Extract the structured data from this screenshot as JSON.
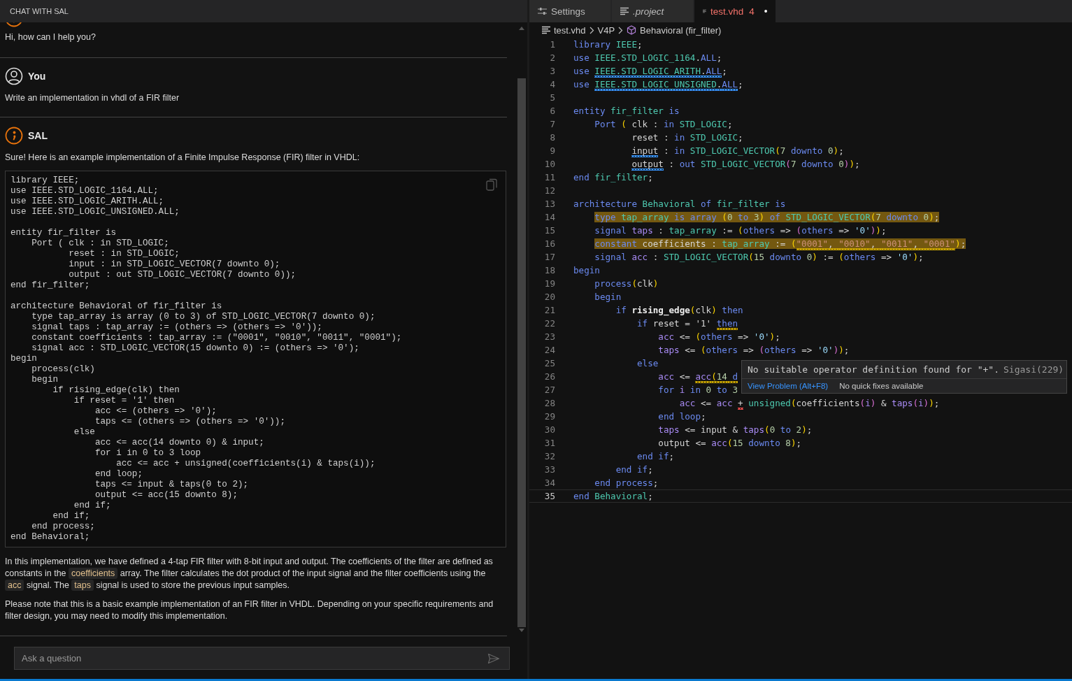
{
  "chat": {
    "title": "CHAT WITH SAL",
    "messages": [
      {
        "kind": "assistant",
        "clipped": true,
        "blocks": [
          {
            "kind": "text",
            "text": "Hi, how can I help you?"
          }
        ]
      },
      {
        "kind": "user",
        "clipped": false,
        "author": "You",
        "blocks": [
          {
            "kind": "text",
            "text": "Write an implementation in vhdl of a FIR filter"
          }
        ]
      },
      {
        "kind": "assistant",
        "clipped": false,
        "author": "SAL",
        "blocks": [
          {
            "kind": "text",
            "text": "Sure! Here is an example implementation of a Finite Impulse Response (FIR) filter in VHDL:"
          },
          {
            "kind": "code",
            "code": "library IEEE;\nuse IEEE.STD_LOGIC_1164.ALL;\nuse IEEE.STD_LOGIC_ARITH.ALL;\nuse IEEE.STD_LOGIC_UNSIGNED.ALL;\n\nentity fir_filter is\n    Port ( clk : in STD_LOGIC;\n           reset : in STD_LOGIC;\n           input : in STD_LOGIC_VECTOR(7 downto 0);\n           output : out STD_LOGIC_VECTOR(7 downto 0));\nend fir_filter;\n\narchitecture Behavioral of fir_filter is\n    type tap_array is array (0 to 3) of STD_LOGIC_VECTOR(7 downto 0);\n    signal taps : tap_array := (others => (others => '0'));\n    constant coefficients : tap_array := (\"0001\", \"0010\", \"0011\", \"0001\");\n    signal acc : STD_LOGIC_VECTOR(15 downto 0) := (others => '0');\nbegin\n    process(clk)\n    begin\n        if rising_edge(clk) then\n            if reset = '1' then\n                acc <= (others => '0');\n                taps <= (others => (others => '0'));\n            else\n                acc <= acc(14 downto 0) & input;\n                for i in 0 to 3 loop\n                    acc <= acc + unsigned(coefficients(i) & taps(i));\n                end loop;\n                taps <= input & taps(0 to 2);\n                output <= acc(15 downto 8);\n            end if;\n        end if;\n    end process;\nend Behavioral;"
          },
          {
            "kind": "rich",
            "parts": [
              {
                "text": "In this implementation, we have defined a 4-tap FIR filter with 8-bit input and output. The coefficients of the filter are defined as constants in the "
              },
              {
                "text": "coefficients",
                "code": true
              },
              {
                "text": " array. The filter calculates the dot product of the input signal and the filter coefficients using the "
              },
              {
                "text": "acc",
                "code": true
              },
              {
                "text": " signal. The "
              },
              {
                "text": "taps",
                "code": true
              },
              {
                "text": " signal is used to store the previous input samples."
              }
            ]
          },
          {
            "kind": "text",
            "text": "Please note that this is a basic example implementation of an FIR filter in VHDL. Depending on your specific requirements and filter design, you may need to modify this implementation."
          }
        ]
      }
    ],
    "input": {
      "placeholder": "Ask a question"
    }
  },
  "editor": {
    "tabs": [
      {
        "label": "Settings",
        "kind": "settings",
        "selected": false,
        "preview": false,
        "modified": false
      },
      {
        "label": ".project",
        "kind": "file",
        "selected": false,
        "preview": true,
        "modified": false
      },
      {
        "label": "test.vhd",
        "kind": "file",
        "selected": true,
        "preview": false,
        "modified": true,
        "problems": "4"
      }
    ],
    "breadcrumb": [
      {
        "label": "test.vhd",
        "kind": "file"
      },
      {
        "label": "V4P",
        "kind": "plain"
      },
      {
        "label": "Behavioral (fir_filter)",
        "kind": "symbol"
      }
    ],
    "lines": [
      {
        "n": "1",
        "seg": [
          {
            "text": "library",
            "kind": "keyword"
          },
          {
            "text": " IEEE",
            "kind": "type"
          },
          {
            "text": ";",
            "kind": "plain"
          }
        ]
      },
      {
        "n": "2",
        "seg": [
          {
            "text": "use ",
            "kind": "keyword"
          },
          {
            "text": "IEEE.STD_LOGIC_1164",
            "kind": "type"
          },
          {
            "text": ".",
            "kind": "plain"
          },
          {
            "text": "ALL",
            "kind": "keyword"
          },
          {
            "text": ";",
            "kind": "plain"
          }
        ]
      },
      {
        "n": "3",
        "seg": [
          {
            "text": "use ",
            "kind": "keyword"
          },
          {
            "text": "IEEE.STD_LOGIC_ARITH",
            "kind": "type",
            "info_squiggle": true
          },
          {
            "text": ".",
            "kind": "plain",
            "info_squiggle": true
          },
          {
            "text": "ALL",
            "kind": "keyword",
            "info_squiggle": true
          },
          {
            "text": ";",
            "kind": "plain"
          }
        ]
      },
      {
        "n": "4",
        "seg": [
          {
            "text": "use ",
            "kind": "keyword"
          },
          {
            "text": "IEEE.STD_LOGIC_UNSIGNED",
            "kind": "type",
            "info_squiggle": true
          },
          {
            "text": ".",
            "kind": "plain",
            "info_squiggle": true
          },
          {
            "text": "ALL",
            "kind": "keyword",
            "info_squiggle": true
          },
          {
            "text": ";",
            "kind": "plain"
          }
        ]
      },
      {
        "n": "5"
      },
      {
        "n": "6",
        "seg": [
          {
            "text": "entity ",
            "kind": "keyword"
          },
          {
            "text": "fir_filter",
            "kind": "type"
          },
          {
            "text": " is",
            "kind": "keyword"
          }
        ]
      },
      {
        "n": "7",
        "seg": [
          {
            "text": "    Port ",
            "kind": "keyword"
          },
          {
            "text": "(",
            "kind": "paren"
          },
          {
            "text": " clk : ",
            "kind": "plain"
          },
          {
            "text": "in ",
            "kind": "keyword"
          },
          {
            "text": "STD_LOGIC",
            "kind": "type"
          },
          {
            "text": ";",
            "kind": "plain"
          }
        ]
      },
      {
        "n": "8",
        "seg": [
          {
            "text": "           reset : ",
            "kind": "plain"
          },
          {
            "text": "in ",
            "kind": "keyword"
          },
          {
            "text": "STD_LOGIC",
            "kind": "type"
          },
          {
            "text": ";",
            "kind": "plain"
          }
        ]
      },
      {
        "n": "9",
        "seg": [
          {
            "text": "           input",
            "kind": "plain",
            "info_squiggle": true
          },
          {
            "text": " : ",
            "kind": "plain"
          },
          {
            "text": "in ",
            "kind": "keyword"
          },
          {
            "text": "STD_LOGIC_VECTOR",
            "kind": "type"
          },
          {
            "text": "(",
            "kind": "paren"
          },
          {
            "text": "7",
            "kind": "number"
          },
          {
            "text": " downto ",
            "kind": "keyword"
          },
          {
            "text": "0",
            "kind": "number"
          },
          {
            "text": ")",
            "kind": "paren"
          },
          {
            "text": ";",
            "kind": "plain"
          }
        ]
      },
      {
        "n": "10",
        "seg": [
          {
            "text": "           output",
            "kind": "plain",
            "info_squiggle": true
          },
          {
            "text": " : ",
            "kind": "plain"
          },
          {
            "text": "out ",
            "kind": "keyword"
          },
          {
            "text": "STD_LOGIC_VECTOR",
            "kind": "type"
          },
          {
            "text": "(",
            "kind": "paren2"
          },
          {
            "text": "7",
            "kind": "number"
          },
          {
            "text": " downto ",
            "kind": "keyword"
          },
          {
            "text": "0",
            "kind": "number"
          },
          {
            "text": ")",
            "kind": "paren2"
          },
          {
            "text": ")",
            "kind": "paren"
          },
          {
            "text": ";",
            "kind": "plain"
          }
        ]
      },
      {
        "n": "11",
        "seg": [
          {
            "text": "end ",
            "kind": "keyword"
          },
          {
            "text": "fir_filter",
            "kind": "type"
          },
          {
            "text": ";",
            "kind": "plain"
          }
        ]
      },
      {
        "n": "12"
      },
      {
        "n": "13",
        "seg": [
          {
            "text": "architecture ",
            "kind": "keyword"
          },
          {
            "text": "Behavioral",
            "kind": "type"
          },
          {
            "text": " of ",
            "kind": "keyword"
          },
          {
            "text": "fir_filter",
            "kind": "type"
          },
          {
            "text": " is",
            "kind": "keyword"
          }
        ]
      },
      {
        "n": "14",
        "highlighted": true,
        "seg": [
          {
            "text": "    type ",
            "kind": "keyword"
          },
          {
            "text": "tap_array",
            "kind": "type"
          },
          {
            "text": " is array ",
            "kind": "keyword"
          },
          {
            "text": "(",
            "kind": "paren"
          },
          {
            "text": "0",
            "kind": "number"
          },
          {
            "text": " to ",
            "kind": "keyword"
          },
          {
            "text": "3",
            "kind": "number"
          },
          {
            "text": ")",
            "kind": "paren"
          },
          {
            "text": " of ",
            "kind": "keyword"
          },
          {
            "text": "STD_LOGIC_VECTOR",
            "kind": "type"
          },
          {
            "text": "(",
            "kind": "paren"
          },
          {
            "text": "7",
            "kind": "number"
          },
          {
            "text": " downto ",
            "kind": "keyword"
          },
          {
            "text": "0",
            "kind": "number"
          },
          {
            "text": ")",
            "kind": "paren"
          },
          {
            "text": ";",
            "kind": "plain"
          }
        ]
      },
      {
        "n": "15",
        "seg": [
          {
            "text": "    signal ",
            "kind": "keyword"
          },
          {
            "text": "taps",
            "kind": "signal"
          },
          {
            "text": " : ",
            "kind": "plain"
          },
          {
            "text": "tap_array",
            "kind": "type"
          },
          {
            "text": " := ",
            "kind": "plain"
          },
          {
            "text": "(",
            "kind": "paren"
          },
          {
            "text": "others",
            "kind": "keyword"
          },
          {
            "text": " => ",
            "kind": "plain"
          },
          {
            "text": "(",
            "kind": "paren2"
          },
          {
            "text": "others",
            "kind": "keyword"
          },
          {
            "text": " => ",
            "kind": "plain"
          },
          {
            "text": "'0'",
            "kind": "char"
          },
          {
            "text": ")",
            "kind": "paren2"
          },
          {
            "text": ")",
            "kind": "paren"
          },
          {
            "text": ";",
            "kind": "plain"
          }
        ]
      },
      {
        "n": "16",
        "highlighted": true,
        "seg": [
          {
            "text": "    constant ",
            "kind": "keyword"
          },
          {
            "text": "coefficients",
            "kind": "plain"
          },
          {
            "text": " : ",
            "kind": "plain"
          },
          {
            "text": "tap_array",
            "kind": "type"
          },
          {
            "text": " := ",
            "kind": "plain"
          },
          {
            "text": "(",
            "kind": "paren"
          },
          {
            "text": "\"0001\"",
            "kind": "string",
            "warning_squiggle": true
          },
          {
            "text": ", ",
            "kind": "plain",
            "warning_squiggle": true
          },
          {
            "text": "\"0010\"",
            "kind": "string",
            "warning_squiggle": true
          },
          {
            "text": ", ",
            "kind": "plain",
            "warning_squiggle": true
          },
          {
            "text": "\"0011\"",
            "kind": "string",
            "warning_squiggle": true
          },
          {
            "text": ", ",
            "kind": "plain",
            "warning_squiggle": true
          },
          {
            "text": "\"0001\"",
            "kind": "string",
            "warning_squiggle": true
          },
          {
            "text": ")",
            "kind": "paren"
          },
          {
            "text": ";",
            "kind": "plain"
          }
        ]
      },
      {
        "n": "17",
        "seg": [
          {
            "text": "    signal ",
            "kind": "keyword"
          },
          {
            "text": "acc",
            "kind": "signal"
          },
          {
            "text": " : ",
            "kind": "plain"
          },
          {
            "text": "STD_LOGIC_VECTOR",
            "kind": "type"
          },
          {
            "text": "(",
            "kind": "paren"
          },
          {
            "text": "15",
            "kind": "number"
          },
          {
            "text": " downto ",
            "kind": "keyword"
          },
          {
            "text": "0",
            "kind": "number"
          },
          {
            "text": ")",
            "kind": "paren"
          },
          {
            "text": " := ",
            "kind": "plain"
          },
          {
            "text": "(",
            "kind": "paren"
          },
          {
            "text": "others",
            "kind": "keyword"
          },
          {
            "text": " => ",
            "kind": "plain"
          },
          {
            "text": "'0'",
            "kind": "char"
          },
          {
            "text": ")",
            "kind": "paren"
          },
          {
            "text": ";",
            "kind": "plain"
          }
        ]
      },
      {
        "n": "18",
        "seg": [
          {
            "text": "begin",
            "kind": "keyword"
          }
        ]
      },
      {
        "n": "19",
        "seg": [
          {
            "text": "    process",
            "kind": "keyword"
          },
          {
            "text": "(",
            "kind": "paren"
          },
          {
            "text": "clk",
            "kind": "plain"
          },
          {
            "text": ")",
            "kind": "paren"
          }
        ]
      },
      {
        "n": "20",
        "seg": [
          {
            "text": "    begin",
            "kind": "keyword"
          }
        ]
      },
      {
        "n": "21",
        "seg": [
          {
            "text": "        if ",
            "kind": "keyword"
          },
          {
            "text": "rising_edge",
            "kind": "function"
          },
          {
            "text": "(",
            "kind": "paren"
          },
          {
            "text": "clk",
            "kind": "plain"
          },
          {
            "text": ")",
            "kind": "paren"
          },
          {
            "text": " then",
            "kind": "keyword"
          }
        ]
      },
      {
        "n": "22",
        "seg": [
          {
            "text": "            if ",
            "kind": "keyword"
          },
          {
            "text": "reset = '1' ",
            "kind": "plain"
          },
          {
            "text": "then",
            "kind": "keyword",
            "warning_squiggle": true
          }
        ]
      },
      {
        "n": "23",
        "seg": [
          {
            "text": "                acc",
            "kind": "signal"
          },
          {
            "text": " <= ",
            "kind": "plain"
          },
          {
            "text": "(",
            "kind": "paren"
          },
          {
            "text": "others",
            "kind": "keyword"
          },
          {
            "text": " => ",
            "kind": "plain"
          },
          {
            "text": "'0'",
            "kind": "char"
          },
          {
            "text": ")",
            "kind": "paren"
          },
          {
            "text": ";",
            "kind": "plain"
          }
        ]
      },
      {
        "n": "24",
        "seg": [
          {
            "text": "                taps",
            "kind": "signal"
          },
          {
            "text": " <= ",
            "kind": "plain"
          },
          {
            "text": "(",
            "kind": "paren"
          },
          {
            "text": "others",
            "kind": "keyword"
          },
          {
            "text": " => ",
            "kind": "plain"
          },
          {
            "text": "(",
            "kind": "paren2"
          },
          {
            "text": "others",
            "kind": "keyword"
          },
          {
            "text": " => ",
            "kind": "plain"
          },
          {
            "text": "'0'",
            "kind": "char"
          },
          {
            "text": ")",
            "kind": "paren2"
          },
          {
            "text": ")",
            "kind": "paren"
          },
          {
            "text": ";",
            "kind": "plain"
          }
        ]
      },
      {
        "n": "25",
        "seg": [
          {
            "text": "            else",
            "kind": "keyword"
          }
        ]
      },
      {
        "n": "26",
        "seg": [
          {
            "text": "                acc",
            "kind": "signal"
          },
          {
            "text": " <= ",
            "kind": "plain"
          },
          {
            "text": "acc",
            "kind": "signal",
            "warning_squiggle": true
          },
          {
            "text": "(",
            "kind": "paren",
            "warning_squiggle": true
          },
          {
            "text": "14",
            "kind": "number",
            "warning_squiggle": true
          },
          {
            "text": " d",
            "kind": "keyword",
            "warning_squiggle": true
          }
        ]
      },
      {
        "n": "27",
        "seg": [
          {
            "text": "                for ",
            "kind": "keyword"
          },
          {
            "text": "i",
            "kind": "signal"
          },
          {
            "text": " in ",
            "kind": "keyword"
          },
          {
            "text": "0",
            "kind": "number"
          },
          {
            "text": " to ",
            "kind": "keyword"
          },
          {
            "text": "3",
            "kind": "number"
          }
        ]
      },
      {
        "n": "28",
        "seg": [
          {
            "text": "                    acc",
            "kind": "signal"
          },
          {
            "text": " <= ",
            "kind": "plain"
          },
          {
            "text": "acc ",
            "kind": "signal"
          },
          {
            "text": "+",
            "kind": "plain",
            "error_squiggle": true
          },
          {
            "text": " unsigned",
            "kind": "type"
          },
          {
            "text": "(",
            "kind": "paren"
          },
          {
            "text": "coefficients",
            "kind": "plain"
          },
          {
            "text": "(",
            "kind": "paren2"
          },
          {
            "text": "i",
            "kind": "signal"
          },
          {
            "text": ")",
            "kind": "paren2"
          },
          {
            "text": " & ",
            "kind": "plain"
          },
          {
            "text": "taps",
            "kind": "signal"
          },
          {
            "text": "(",
            "kind": "paren2"
          },
          {
            "text": "i",
            "kind": "signal"
          },
          {
            "text": ")",
            "kind": "paren2"
          },
          {
            "text": ")",
            "kind": "paren"
          },
          {
            "text": ";",
            "kind": "plain"
          }
        ]
      },
      {
        "n": "29",
        "seg": [
          {
            "text": "                end loop",
            "kind": "keyword"
          },
          {
            "text": ";",
            "kind": "plain"
          }
        ]
      },
      {
        "n": "30",
        "seg": [
          {
            "text": "                taps",
            "kind": "signal"
          },
          {
            "text": " <= ",
            "kind": "plain"
          },
          {
            "text": "input",
            "kind": "plain"
          },
          {
            "text": " & ",
            "kind": "plain"
          },
          {
            "text": "taps",
            "kind": "signal"
          },
          {
            "text": "(",
            "kind": "paren"
          },
          {
            "text": "0",
            "kind": "number"
          },
          {
            "text": " to ",
            "kind": "keyword"
          },
          {
            "text": "2",
            "kind": "number"
          },
          {
            "text": ")",
            "kind": "paren"
          },
          {
            "text": ";",
            "kind": "plain"
          }
        ]
      },
      {
        "n": "31",
        "seg": [
          {
            "text": "                output",
            "kind": "plain"
          },
          {
            "text": " <= ",
            "kind": "plain"
          },
          {
            "text": "acc",
            "kind": "signal"
          },
          {
            "text": "(",
            "kind": "paren"
          },
          {
            "text": "15",
            "kind": "number"
          },
          {
            "text": " downto ",
            "kind": "keyword"
          },
          {
            "text": "8",
            "kind": "number"
          },
          {
            "text": ")",
            "kind": "paren"
          },
          {
            "text": ";",
            "kind": "plain"
          }
        ]
      },
      {
        "n": "32",
        "seg": [
          {
            "text": "            end if",
            "kind": "keyword"
          },
          {
            "text": ";",
            "kind": "plain"
          }
        ]
      },
      {
        "n": "33",
        "seg": [
          {
            "text": "        end if",
            "kind": "keyword"
          },
          {
            "text": ";",
            "kind": "plain"
          }
        ]
      },
      {
        "n": "34",
        "seg": [
          {
            "text": "    end process",
            "kind": "keyword"
          },
          {
            "text": ";",
            "kind": "plain"
          }
        ]
      },
      {
        "n": "35",
        "current": true,
        "seg": [
          {
            "text": "end ",
            "kind": "keyword"
          },
          {
            "text": "Behavioral",
            "kind": "type"
          },
          {
            "text": ";",
            "kind": "plain"
          }
        ]
      }
    ],
    "hover": {
      "message": "No suitable operator definition found for \"+\".",
      "source": "Sigasi(229)",
      "action": "View Problem (Alt+F8)",
      "note": "No quick fixes available"
    }
  }
}
